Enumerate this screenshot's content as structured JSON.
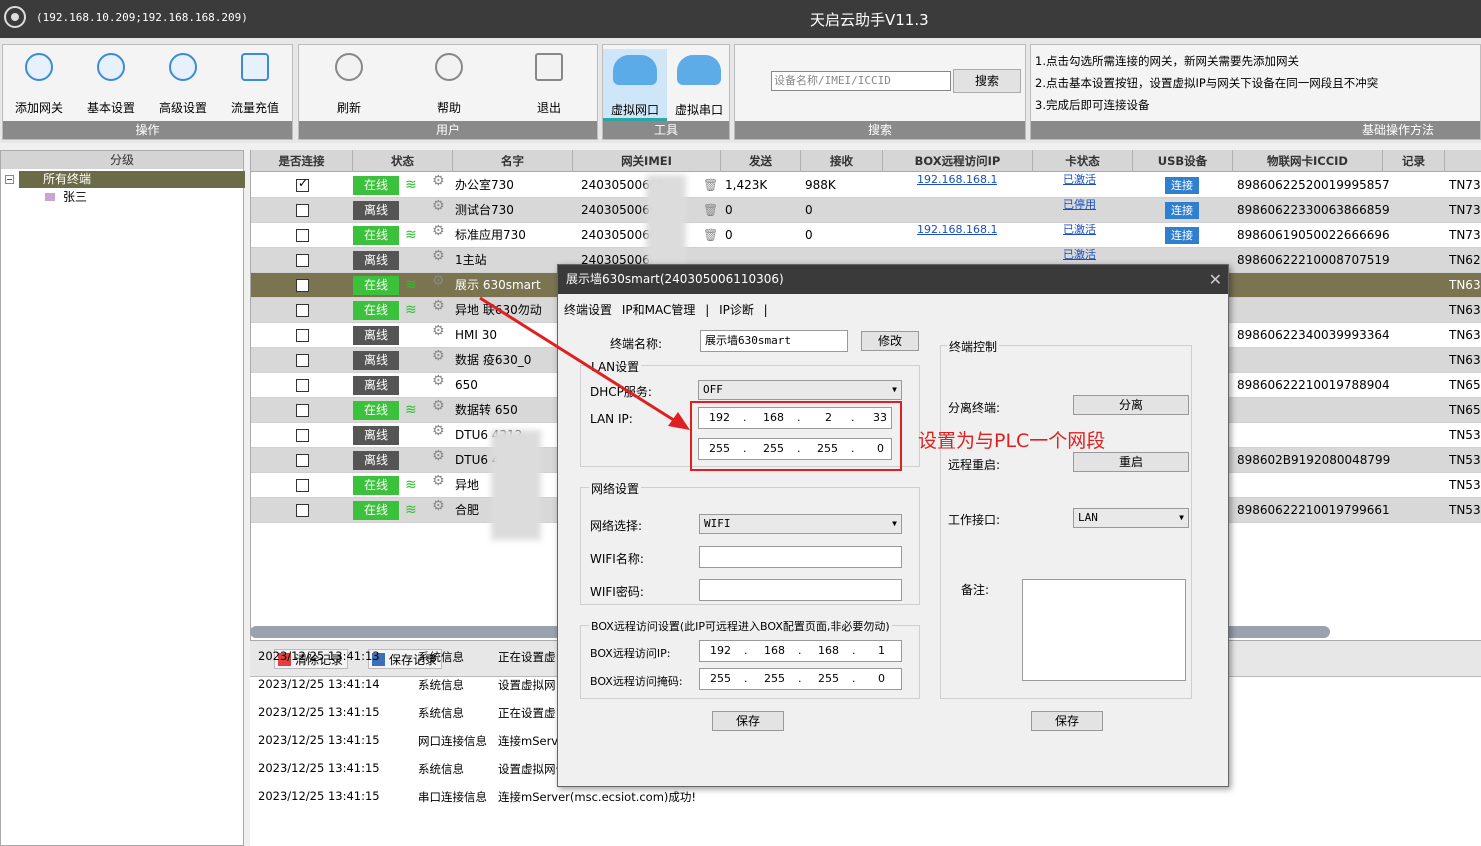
{
  "titlebar": {
    "ips": "(192.168.10.209;192.168.168.209)",
    "title": "天启云助手V11.3"
  },
  "toolbar": {
    "ops": {
      "caption": "操作",
      "buttons": [
        "添加网关",
        "基本设置",
        "高级设置",
        "流量充值"
      ]
    },
    "user": {
      "caption": "用户",
      "buttons": [
        "刷新",
        "帮助",
        "退出"
      ]
    },
    "tools": {
      "caption": "工具",
      "buttons": [
        "虚拟网口",
        "虚拟串口"
      ]
    },
    "search": {
      "caption": "搜索",
      "placeholder": "设备名称/IMEI/ICCID",
      "button": "搜索"
    },
    "tips": {
      "caption": "基础操作方法",
      "lines": [
        "1.点击勾选所需连接的网关，新网关需要先添加网关",
        "2.点击基本设置按钮，设置虚拟IP与网关下设备在同一网段且不冲突",
        "3.完成后即可连接设备"
      ]
    }
  },
  "tree": {
    "header": "分级",
    "root": "所有终端",
    "child": "张三"
  },
  "grid": {
    "headers": [
      "是否连接",
      "状态",
      "名字",
      "网关IMEI",
      "发送",
      "接收",
      "BOX远程访问IP",
      "卡状态",
      "USB设备",
      "物联网卡ICCID",
      "记录"
    ],
    "rows": [
      {
        "checked": true,
        "status": "在线",
        "name": "办公室730",
        "imei": "24030500601",
        "send": "1,423K",
        "recv": "988K",
        "boxip": "192.168.168.1",
        "card": "已激活",
        "usb": "连接",
        "iccid": "89860622520019995857",
        "rec": "TN73"
      },
      {
        "checked": false,
        "status": "离线",
        "name": "测试台730",
        "imei": "24030500600",
        "send": "0",
        "recv": "0",
        "boxip": "",
        "card": "已停用",
        "usb": "连接",
        "iccid": "89860622330063866859",
        "rec": "TN73"
      },
      {
        "checked": false,
        "status": "在线",
        "name": "标准应用730",
        "imei": "24030500600",
        "send": "0",
        "recv": "0",
        "boxip": "192.168.168.1",
        "card": "已激活",
        "usb": "连接",
        "iccid": "89860619050022666696",
        "rec": "TN73"
      },
      {
        "checked": false,
        "status": "离线",
        "name": "1主站",
        "imei": "24030500600",
        "send": "",
        "recv": "",
        "boxip": "",
        "card": "已激活",
        "usb": "",
        "iccid": "89860622210008707519",
        "rec": "TN62"
      },
      {
        "checked": false,
        "status": "在线",
        "name": "展示    630smart",
        "imei": "",
        "send": "",
        "recv": "",
        "boxip": "",
        "card": "",
        "usb": "",
        "iccid": "",
        "rec": "TN63"
      },
      {
        "checked": false,
        "status": "在线",
        "name": "异地    联630勿动",
        "imei": "",
        "send": "",
        "recv": "",
        "boxip": "",
        "card": "",
        "usb": "",
        "iccid": "",
        "rec": "TN63"
      },
      {
        "checked": false,
        "status": "离线",
        "name": "HMI    30",
        "imei": "",
        "send": "",
        "recv": "",
        "boxip": "",
        "card": "",
        "usb": "",
        "iccid": "89860622340039993364",
        "rec": "TN63"
      },
      {
        "checked": false,
        "status": "离线",
        "name": "数据    疫630_0",
        "imei": "",
        "send": "",
        "recv": "",
        "boxip": "",
        "card": "",
        "usb": "",
        "iccid": "",
        "rec": "TN63"
      },
      {
        "checked": false,
        "status": "离线",
        "name": "650",
        "imei": "",
        "send": "",
        "recv": "",
        "boxip": "",
        "card": "",
        "usb": "",
        "iccid": "89860622210019788904",
        "rec": "TN65"
      },
      {
        "checked": false,
        "status": "在线",
        "name": "数据转    650",
        "imei": "",
        "send": "",
        "recv": "",
        "boxip": "",
        "card": "",
        "usb": "",
        "iccid": "",
        "rec": "TN65"
      },
      {
        "checked": false,
        "status": "离线",
        "name": "DTU6    4212",
        "imei": "",
        "send": "",
        "recv": "",
        "boxip": "",
        "card": "",
        "usb": "",
        "iccid": "",
        "rec": "TN53"
      },
      {
        "checked": false,
        "status": "离线",
        "name": "DTU6    4274",
        "imei": "",
        "send": "",
        "recv": "",
        "boxip": "",
        "card": "",
        "usb": "",
        "iccid": "898602B9192080048799",
        "rec": "TN53"
      },
      {
        "checked": false,
        "status": "在线",
        "name": "异地",
        "imei": "",
        "send": "",
        "recv": "",
        "boxip": "",
        "card": "",
        "usb": "",
        "iccid": "",
        "rec": "TN53"
      },
      {
        "checked": false,
        "status": "在线",
        "name": "合肥",
        "imei": "",
        "send": "",
        "recv": "",
        "boxip": "",
        "card": "",
        "usb": "",
        "iccid": "89860622210019799661",
        "rec": "TN53"
      }
    ]
  },
  "log": {
    "clear": "清除记录",
    "save": "保存记录",
    "lines": [
      {
        "time": "2023/12/25 13:41:13",
        "type": "系统信息",
        "msg": "正在设置虚"
      },
      {
        "time": "2023/12/25 13:41:14",
        "type": "系统信息",
        "msg": "设置虚拟网"
      },
      {
        "time": "2023/12/25 13:41:15",
        "type": "系统信息",
        "msg": "正在设置虚"
      },
      {
        "time": "2023/12/25 13:41:15",
        "type": "网口连接信息",
        "msg": "连接mServe"
      },
      {
        "time": "2023/12/25 13:41:15",
        "type": "系统信息",
        "msg": "设置虚拟网卡IP地址成功"
      },
      {
        "time": "2023/12/25 13:41:15",
        "type": "串口连接信息",
        "msg": "连接mServer(msc.ecsiot.com)成功!"
      }
    ]
  },
  "dialog": {
    "title": "展示墙630smart(240305006110306)",
    "tabs": [
      "终端设置",
      "IP和MAC管理",
      "|",
      "IP诊断",
      "|"
    ],
    "name_label": "终端名称:",
    "name_value": "展示墙630smart",
    "modify": "修改",
    "lan_legend": "LAN设置",
    "dhcp_label": "DHCP服务:",
    "dhcp_value": "OFF",
    "lanip_label": "LAN IP:",
    "lan_ip": [
      "192",
      "168",
      "2",
      "33"
    ],
    "lan_mask": [
      "255",
      "255",
      "255",
      "0"
    ],
    "net_legend": "网络设置",
    "net_sel_label": "网络选择:",
    "net_sel_value": "WIFI",
    "wifi_name_label": "WIFI名称:",
    "wifi_pwd_label": "WIFI密码:",
    "box_legend": "BOX远程访问设置(此IP可远程进入BOX配置页面,非必要勿动)",
    "box_ip_label": "BOX远程访问IP:",
    "box_ip": [
      "192",
      "168",
      "168",
      "1"
    ],
    "box_mask_label": "BOX远程访问掩码:",
    "box_mask": [
      "255",
      "255",
      "255",
      "0"
    ],
    "save": "保存",
    "ctrl_legend": "终端控制",
    "detach_label": "分离终端:",
    "detach_btn": "分离",
    "reboot_label": "远程重启:",
    "reboot_btn": "重启",
    "port_label": "工作接口:",
    "port_value": "LAN",
    "remark_label": "备注:",
    "save2": "保存"
  },
  "annotation": "设置为与PLC一个网段",
  "colors": {
    "online": "#3cc13c",
    "offline": "#555555",
    "annotation": "#e02020",
    "selected_row": "#7a7451"
  }
}
